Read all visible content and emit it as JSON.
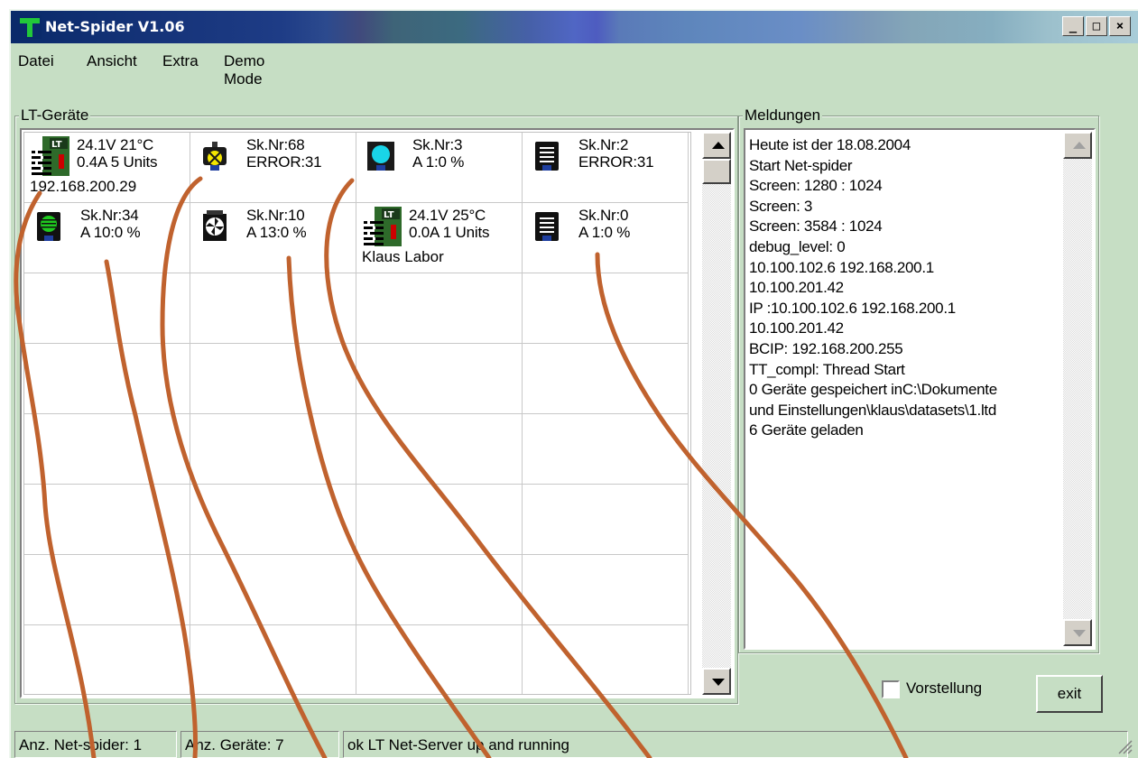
{
  "window": {
    "title": "Net-Spider V1.06",
    "minimize": "_",
    "maximize": "□",
    "close": "×"
  },
  "menu": [
    "Datei",
    "Ansicht",
    "Extra",
    "Demo Mode"
  ],
  "devices_panel": {
    "label": "LT-Geräte",
    "cells": [
      {
        "icon": "lt-rack-icon",
        "line1": "24.1V  21°C",
        "line2": " 0.4A 5 Units",
        "line3": "192.168.200.29"
      },
      {
        "icon": "lamp-device-icon",
        "line1": "Sk.Nr:68",
        "line2": "ERROR:31",
        "line3": ""
      },
      {
        "icon": "cyan-display-device-icon",
        "line1": "Sk.Nr:3",
        "line2": "A  1:0 %",
        "line3": ""
      },
      {
        "icon": "black-panel-device-icon",
        "line1": "Sk.Nr:2",
        "line2": "ERROR:31",
        "line3": ""
      },
      {
        "icon": "green-panel-device-icon",
        "line1": "Sk.Nr:34",
        "line2": "A 10:0 %",
        "line3": ""
      },
      {
        "icon": "fan-device-icon",
        "line1": "Sk.Nr:10",
        "line2": "A 13:0 %",
        "line3": ""
      },
      {
        "icon": "lt-rack-icon",
        "line1": "24.1V  25°C",
        "line2": " 0.0A 1 Units",
        "line3": "Klaus Labor"
      },
      {
        "icon": "black-panel-device-icon",
        "line1": "Sk.Nr:0",
        "line2": "A  1:0 %",
        "line3": ""
      }
    ]
  },
  "messages_panel": {
    "label": "Meldungen",
    "lines": [
      "Heute ist der 18.08.2004",
      "Start Net-spider",
      "Screen: 1280 : 1024",
      "Screen: 3",
      "Screen: 3584 : 1024",
      "debug_level: 0",
      "10.100.102.6 192.168.200.1",
      "10.100.201.42",
      "IP :10.100.102.6 192.168.200.1",
      "10.100.201.42",
      "BCIP: 192.168.200.255",
      "TT_compl: Thread Start",
      "0 Geräte gespeichert inC:\\Dokumente",
      "und Einstellungen\\klaus\\datasets\\1.ltd",
      "6 Geräte geladen"
    ]
  },
  "vorstellung": {
    "label": "Vorstellung",
    "checked": false
  },
  "exit_label": "exit",
  "status": {
    "spiders": "Anz. Net-spider: 1",
    "devices": "Anz. Geräte: 7",
    "message": "ok LT Net-Server up and running"
  },
  "colors": {
    "window_bg": "#c6dec4",
    "scribble": "#c0622e"
  }
}
